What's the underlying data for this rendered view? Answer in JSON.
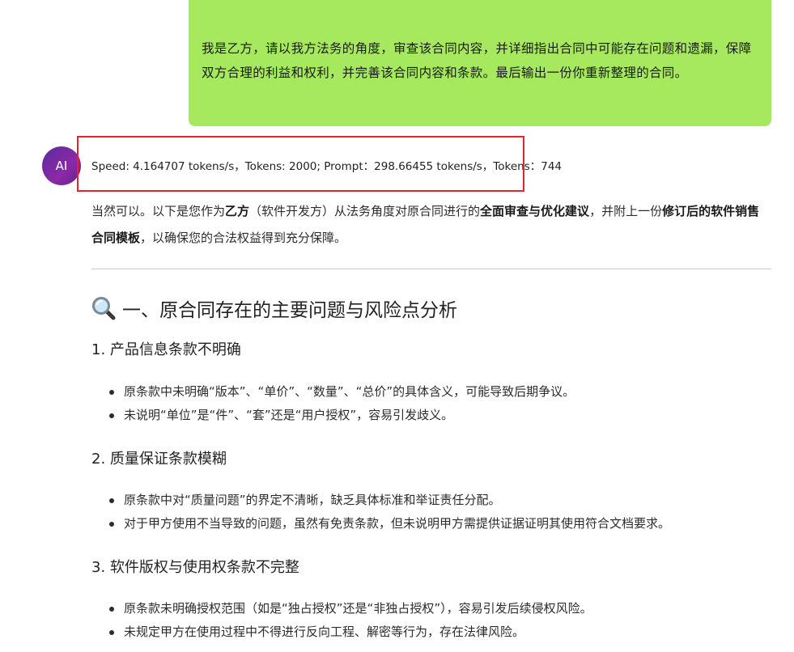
{
  "user_message": {
    "text": "我是乙方，请以我方法务的角度，审查该合同内容，并详细指出合同中可能存在问题和遗漏，保障双方合理的利益和权利，并完善该合同内容和条款。最后输出一份你重新整理的合同。"
  },
  "assistant": {
    "avatar_label": "AI",
    "stats": "Speed: 4.164707 tokens/s，Tokens: 2000; Prompt：298.66455 tokens/s，Tokens：744",
    "intro": {
      "p1": "当然可以。以下是您作为",
      "b1": "乙方",
      "p2": "（软件开发方）从法务角度对原合同进行的",
      "b2": "全面审查与优化建议",
      "p3": "，并附上一份",
      "b3": "修订后的软件销售合同模板",
      "p4": "，以确保您的合法权益得到充分保障。"
    },
    "section_title": "一、原合同存在的主要问题与风险点分析",
    "sections": [
      {
        "heading": "1. 产品信息条款不明确",
        "bullets": [
          "原条款中未明确“版本”、“单价”、“数量”、“总价”的具体含义，可能导致后期争议。",
          "未说明“单位”是“件”、“套”还是“用户授权”，容易引发歧义。"
        ]
      },
      {
        "heading": "2. 质量保证条款模糊",
        "bullets": [
          "原条款中对“质量问题”的界定不清晰，缺乏具体标准和举证责任分配。",
          "对于甲方使用不当导致的问题，虽然有免责条款，但未说明甲方需提供证据证明其使用符合文档要求。"
        ]
      },
      {
        "heading": "3. 软件版权与使用权条款不完整",
        "bullets": [
          "原条款未明确授权范围（如是“独占授权”还是“非独占授权”），容易引发后续侵权风险。",
          "未规定甲方在使用过程中不得进行反向工程、解密等行为，存在法律风险。"
        ]
      }
    ]
  },
  "icons": {
    "section_icon": "magnifying-glass-icon"
  },
  "colors": {
    "user_bubble": "#a6e95f",
    "highlight_border": "#e8212a",
    "avatar_gradient_start": "#5b2a9e",
    "avatar_gradient_end": "#8a2aa6"
  }
}
